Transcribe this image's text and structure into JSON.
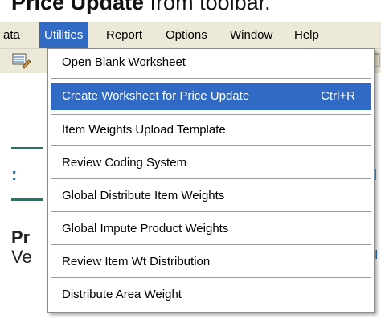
{
  "heading": {
    "bold_text": "Price Update",
    "normal_text": " from toolbar."
  },
  "menubar": {
    "items": [
      {
        "label": "ata"
      },
      {
        "label": "Utilities"
      },
      {
        "label": "Report"
      },
      {
        "label": "Options"
      },
      {
        "label": "Window"
      },
      {
        "label": "Help"
      }
    ]
  },
  "background": {
    "fragment_pr": "Pr",
    "fragment_ve": "Ve",
    "fragment_colon": ":",
    "fragment_right_i": "I"
  },
  "dropdown": {
    "items": [
      {
        "label": "Open Blank Worksheet",
        "shortcut": ""
      },
      {
        "label": "Create Worksheet for Price Update",
        "shortcut": "Ctrl+R"
      },
      {
        "label": "Item Weights Upload Template",
        "shortcut": ""
      },
      {
        "label": "Review Coding System",
        "shortcut": ""
      },
      {
        "label": "Global Distribute Item Weights",
        "shortcut": ""
      },
      {
        "label": "Global Impute Product Weights",
        "shortcut": ""
      },
      {
        "label": "Review Item Wt Distribution",
        "shortcut": ""
      },
      {
        "label": "Distribute Area Weight",
        "shortcut": ""
      }
    ]
  },
  "colors": {
    "highlight": "#316ac5",
    "menubar_bg": "#ece9d8",
    "accent": "#1f6fa8"
  }
}
